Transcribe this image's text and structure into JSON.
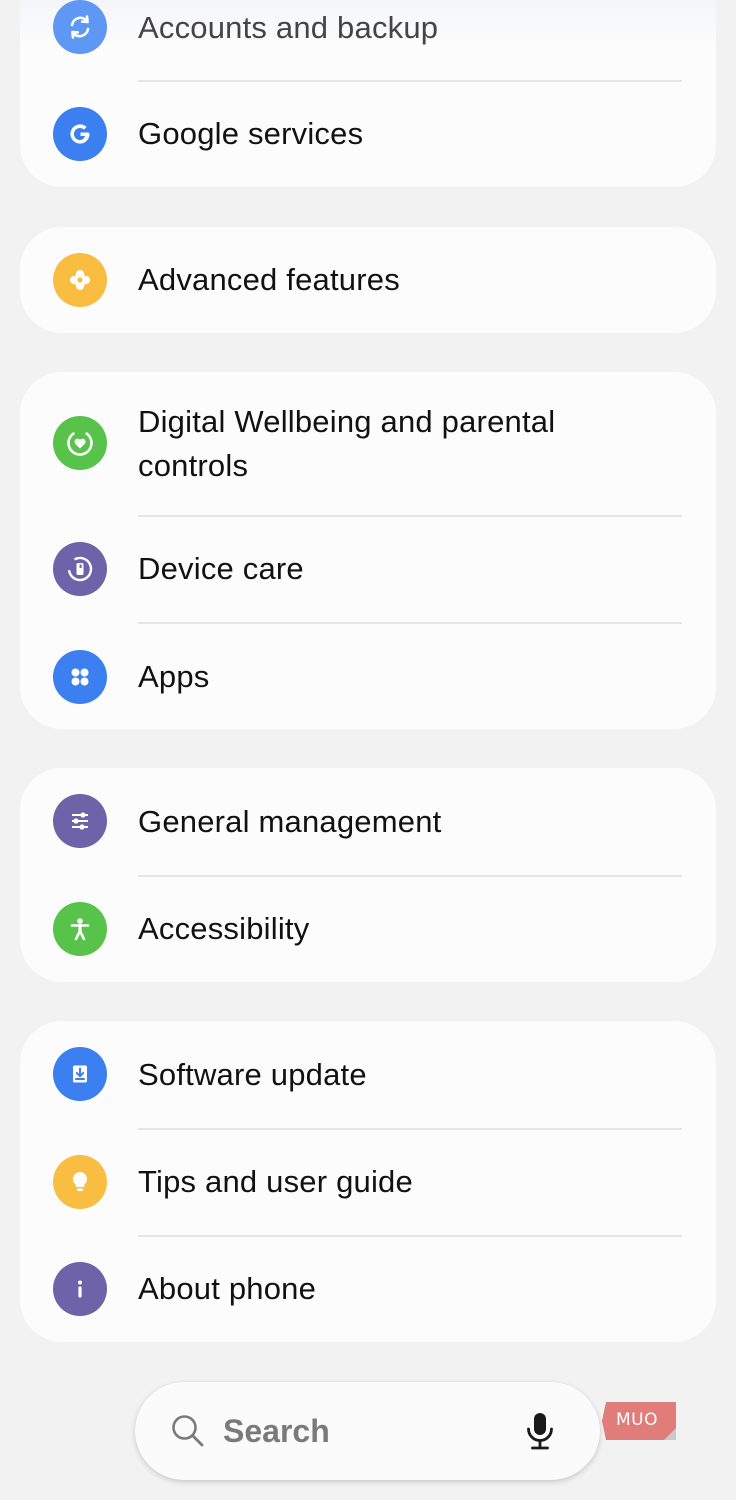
{
  "groups": [
    {
      "items": [
        {
          "label": "Accounts and backup",
          "icon": "sync-icon",
          "color": "#5f97f4"
        },
        {
          "label": "Google services",
          "icon": "google-icon",
          "color": "#3b7ff0"
        }
      ]
    },
    {
      "items": [
        {
          "label": "Advanced features",
          "icon": "puzzle-icon",
          "color": "#f9bd42"
        }
      ]
    },
    {
      "items": [
        {
          "label": "Digital Wellbeing and parental controls",
          "icon": "wellbeing-icon",
          "color": "#58c34a"
        },
        {
          "label": "Device care",
          "icon": "device-care-icon",
          "color": "#6e63a9"
        },
        {
          "label": "Apps",
          "icon": "apps-icon",
          "color": "#3b7ff0"
        }
      ]
    },
    {
      "items": [
        {
          "label": "General management",
          "icon": "sliders-icon",
          "color": "#6e63a9"
        },
        {
          "label": "Accessibility",
          "icon": "accessibility-icon",
          "color": "#58c34a"
        }
      ]
    },
    {
      "items": [
        {
          "label": "Software update",
          "icon": "download-icon",
          "color": "#3b7ff0"
        },
        {
          "label": "Tips and user guide",
          "icon": "lightbulb-icon",
          "color": "#f9bd42"
        },
        {
          "label": "About phone",
          "icon": "info-icon",
          "color": "#6e63a9"
        }
      ]
    }
  ],
  "search": {
    "placeholder": "Search"
  },
  "watermark": {
    "text": "MUO",
    "color": "#e07c7a"
  }
}
